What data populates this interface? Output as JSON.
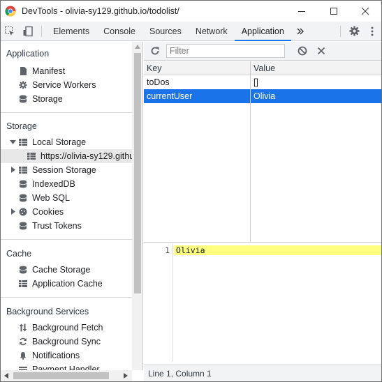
{
  "window": {
    "title": "DevTools - olivia-sy129.github.io/todolist/"
  },
  "tabs": [
    {
      "label": "Elements"
    },
    {
      "label": "Console"
    },
    {
      "label": "Sources"
    },
    {
      "label": "Network"
    },
    {
      "label": "Application",
      "active": true
    }
  ],
  "sidebar": {
    "sections": {
      "application": {
        "title": "Application",
        "items": [
          {
            "label": "Manifest",
            "icon": "document-icon"
          },
          {
            "label": "Service Workers",
            "icon": "gear-icon"
          },
          {
            "label": "Storage",
            "icon": "database-icon"
          }
        ]
      },
      "storage": {
        "title": "Storage",
        "local_storage": {
          "label": "Local Storage",
          "child": "https://olivia-sy129.githu"
        },
        "items": [
          {
            "label": "Session Storage",
            "icon": "grid-icon"
          },
          {
            "label": "IndexedDB",
            "icon": "database-icon"
          },
          {
            "label": "Web SQL",
            "icon": "database-icon"
          },
          {
            "label": "Cookies",
            "icon": "cookie-icon"
          },
          {
            "label": "Trust Tokens",
            "icon": "database-icon"
          }
        ]
      },
      "cache": {
        "title": "Cache",
        "items": [
          {
            "label": "Cache Storage",
            "icon": "database-icon"
          },
          {
            "label": "Application Cache",
            "icon": "grid-icon"
          }
        ]
      },
      "background": {
        "title": "Background Services",
        "items": [
          {
            "label": "Background Fetch",
            "icon": "updown-arrows-icon"
          },
          {
            "label": "Background Sync",
            "icon": "sync-icon"
          },
          {
            "label": "Notifications",
            "icon": "bell-icon"
          },
          {
            "label": "Payment Handler",
            "icon": "card-icon"
          }
        ]
      }
    }
  },
  "filter": {
    "placeholder": "Filter"
  },
  "table": {
    "headers": {
      "key": "Key",
      "value": "Value"
    },
    "rows": [
      {
        "key": "toDos",
        "value": "[]"
      },
      {
        "key": "currentUser",
        "value": "Olivia",
        "selected": true
      }
    ]
  },
  "editor": {
    "line_number": "1",
    "content": "Olivia"
  },
  "status": {
    "position": "Line 1, Column 1"
  },
  "colors": {
    "accent": "#1a73e8",
    "highlight": "#ffff80"
  }
}
